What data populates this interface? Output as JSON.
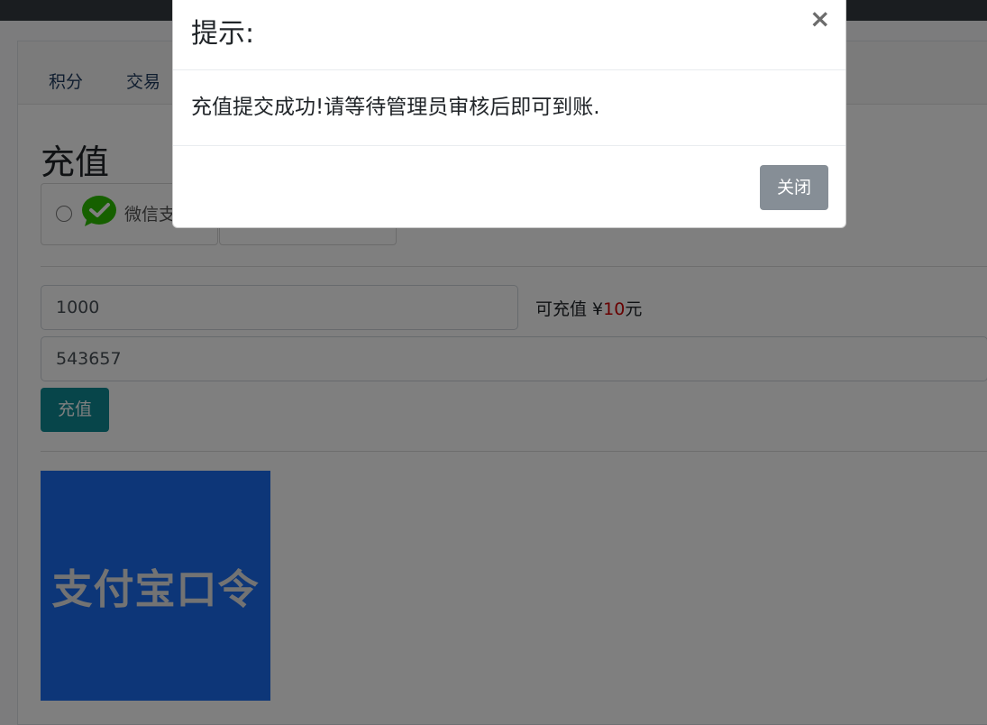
{
  "tabs": [
    "积分",
    "交易"
  ],
  "page": {
    "title": "充值"
  },
  "payment": {
    "option_wechat_label": "微信支"
  },
  "form": {
    "amount_value": "1000",
    "hint_prefix": "可充值 ¥",
    "hint_amount": "10",
    "hint_suffix": "元",
    "code_value": "543657",
    "submit_label": "充值"
  },
  "qr": {
    "label": "支付宝口令"
  },
  "modal": {
    "title": "提示:",
    "close_icon": "×",
    "message": "充值提交成功!请等待管理员审核后即可到账.",
    "close_button_label": "关闭"
  },
  "colors": {
    "accent": "#0e8a94",
    "modal_button": "#868e96",
    "alipay_blue": "#1b6cf1",
    "wechat_green": "#2dc100",
    "amount_red": "#d00000"
  }
}
